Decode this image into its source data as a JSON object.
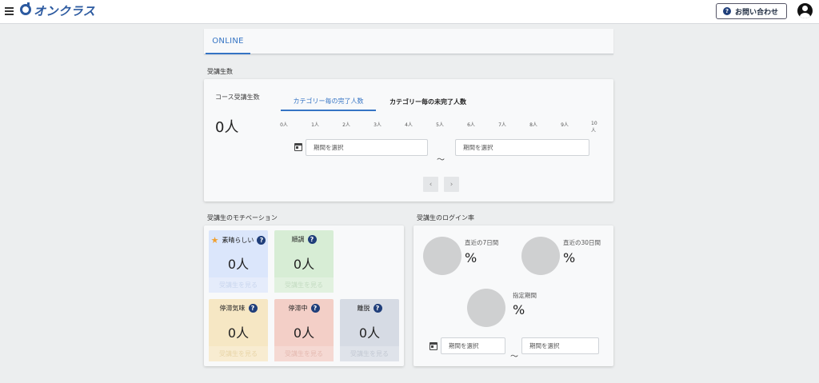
{
  "header": {
    "logo_text": "オンクラス",
    "contact_label": "お問い合わせ"
  },
  "tabs": [
    {
      "label": "ONLINE"
    }
  ],
  "students": {
    "section_label": "受講生数",
    "course_label": "コース受講生数",
    "total": "0人",
    "subtabs": [
      "カテゴリー毎の完了人数",
      "カテゴリー毎の未完了人数"
    ],
    "ticks": [
      "0人",
      "1人",
      "2人",
      "3人",
      "4人",
      "5人",
      "6人",
      "7人",
      "8人",
      "9人",
      "10人"
    ],
    "date_placeholder": "期間を選択",
    "tilde": "〜",
    "prev": "‹",
    "next": "›"
  },
  "motivation": {
    "section_label": "受講生のモチベーション",
    "cards": [
      {
        "label": "素晴らしい",
        "value": "0人",
        "link": "受講生を見る",
        "bg": "#dbe6fb",
        "link_bg": "#e5ecfb",
        "link_color": "#c9d6ee",
        "star": true
      },
      {
        "label": "順調",
        "value": "0人",
        "link": "受講生を見る",
        "bg": "#d7edd5",
        "link_bg": "#e1f1df",
        "link_color": "#c4dcc2",
        "star": false
      },
      {
        "label": "停滞気味",
        "value": "0人",
        "link": "受講生を見る",
        "bg": "#f6e7c4",
        "link_bg": "#f8ecd1",
        "link_color": "#e8d5a8",
        "star": false
      },
      {
        "label": "停滞中",
        "value": "0人",
        "link": "受講生を見る",
        "bg": "#f3cfc7",
        "link_bg": "#f5d9d3",
        "link_color": "#e5bab1",
        "star": false
      },
      {
        "label": "離脱",
        "value": "0人",
        "link": "受講生を見る",
        "bg": "#d6dbe4",
        "link_bg": "#dfe3ea",
        "link_color": "#c3c9d3",
        "star": false
      }
    ]
  },
  "login": {
    "section_label": "受講生のログイン率",
    "rates": [
      {
        "label": "直近の7日間",
        "value": "%"
      },
      {
        "label": "直近の30日間",
        "value": "%"
      },
      {
        "label": "指定期間",
        "value": "%"
      }
    ],
    "date_placeholder": "期間を選択",
    "tilde": "〜"
  }
}
